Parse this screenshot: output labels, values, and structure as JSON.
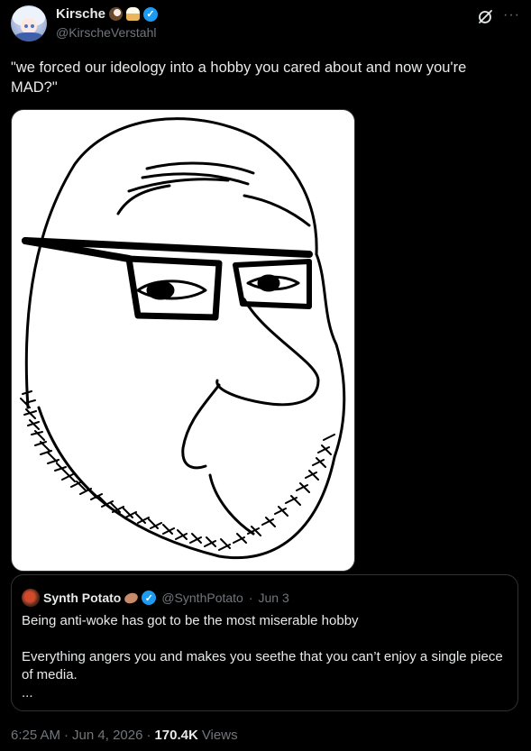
{
  "tweet": {
    "author": {
      "display_name": "Kirsche",
      "handle": "@KirscheVerstahl",
      "emojis": [
        "coconut-emoji",
        "cupcake-emoji"
      ],
      "verified": true
    },
    "text": "\"we forced our ideology into a hobby you cared about and now you're MAD?\"",
    "media": {
      "type": "image",
      "icon": "wojak-drawing"
    },
    "quote": {
      "author": {
        "display_name": "Synth Potato",
        "handle": "@SynthPotato",
        "date": "Jun 3",
        "emoji": "potato-emoji",
        "verified": true
      },
      "text": "Being anti-woke has got to be the most miserable hobby\n\nEverything angers you and makes you seethe that you can’t enjoy a single piece of media.\n..."
    },
    "meta": {
      "time": "6:25 AM",
      "date": "Jun 4, 2026",
      "views_count": "170.4K",
      "views_label": "Views"
    }
  },
  "colors": {
    "background": "#000000",
    "text": "#e7e9ea",
    "secondary": "#71767b",
    "verified": "#1d9bf0",
    "border": "#2f3336"
  }
}
